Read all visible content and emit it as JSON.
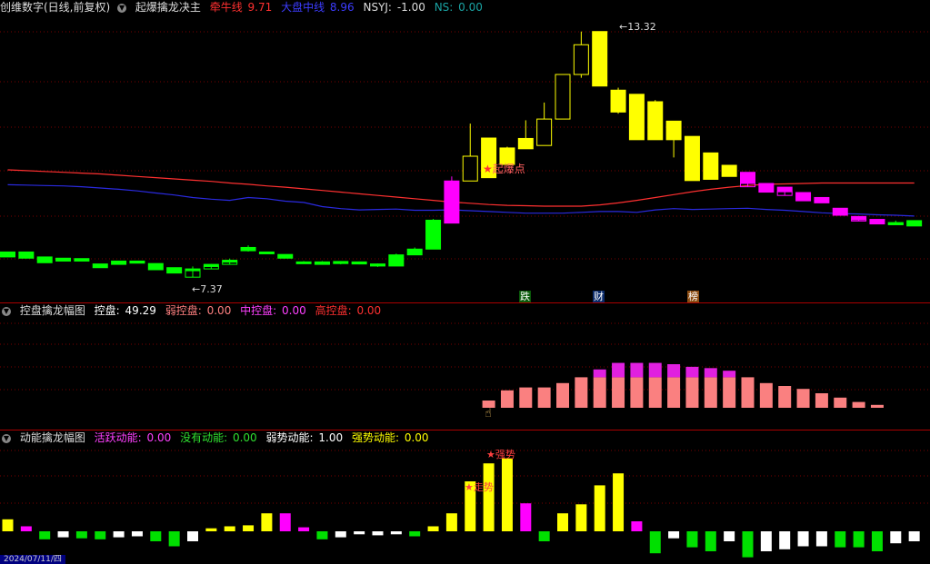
{
  "main": {
    "indicator_label": "创维数字(日线,前复权)",
    "formula_name": "起爆擒龙决主",
    "line1_label": "牵牛线",
    "line1_value": "9.71",
    "line2_label": "大盘中线",
    "line2_value": "8.96",
    "nsyj_label": "NSYJ:",
    "nsyj_value": "-1.00",
    "ns_label": "NS:",
    "ns_value": "0.00",
    "high_marker": "13.32",
    "low_marker": "7.37",
    "signal_text": "起爆点",
    "bottom_tags": [
      "跌",
      "财",
      "榜"
    ],
    "colors": {
      "up_yellow": "#ffff00",
      "down_green": "#00ff00",
      "magenta": "#ff00ff",
      "red_line": "#ff3030",
      "blue_line": "#2a2ae0"
    }
  },
  "sub1": {
    "title": "控盘擒龙幅图",
    "kp_label": "控盘:",
    "kp_value": "49.29",
    "weak_label": "弱控盘:",
    "weak_value": "0.00",
    "mid_label": "中控盘:",
    "mid_value": "0.00",
    "high_label": "高控盘:",
    "high_value": "0.00"
  },
  "sub2": {
    "title": "动能擒龙幅图",
    "active_label": "活跃动能:",
    "active_value": "0.00",
    "none_label": "没有动能:",
    "none_value": "0.00",
    "weak_label": "弱势动能:",
    "weak_value": "1.00",
    "strong_label": "强势动能:",
    "strong_value": "0.00",
    "signal_a": "走势",
    "signal_b": "强势",
    "date": "2024/07/11/四"
  },
  "chart_data": [
    {
      "type": "candlestick",
      "title": "起爆擒龙决主",
      "x": [
        1,
        2,
        3,
        4,
        5,
        6,
        7,
        8,
        9,
        10,
        11,
        12,
        13,
        14,
        15,
        16,
        17,
        18,
        19,
        20,
        21,
        22,
        23,
        24,
        25,
        26,
        27,
        28,
        29,
        30,
        31,
        32,
        33,
        34,
        35,
        36,
        37,
        38,
        39,
        40,
        41,
        42,
        43,
        44,
        45,
        46,
        47,
        48,
        49,
        50
      ],
      "open": [
        7.98,
        7.98,
        7.86,
        7.83,
        7.82,
        7.69,
        7.76,
        7.76,
        7.7,
        7.6,
        7.55,
        7.68,
        7.74,
        8.01,
        7.98,
        7.92,
        7.74,
        7.74,
        7.75,
        7.74,
        7.69,
        7.64,
        7.91,
        8.05,
        8.68,
        9.7,
        10.74,
        10.5,
        10.73,
        10.56,
        11.2,
        12.28,
        13.32,
        11.9,
        11.8,
        11.62,
        11.15,
        10.78,
        10.38,
        10.08,
        9.91,
        9.64,
        9.55,
        9.42,
        9.3,
        9.04,
        8.84,
        8.77,
        8.69,
        8.74
      ],
      "close": [
        7.86,
        7.83,
        7.72,
        7.76,
        7.76,
        7.6,
        7.68,
        7.71,
        7.55,
        7.47,
        7.57,
        7.63,
        7.78,
        8.09,
        7.94,
        7.83,
        7.7,
        7.72,
        7.7,
        7.69,
        7.64,
        7.91,
        8.05,
        8.75,
        9.7,
        10.3,
        9.78,
        10.1,
        10.48,
        11.2,
        12.28,
        13.0,
        12.0,
        11.37,
        10.7,
        10.7,
        10.7,
        9.71,
        9.74,
        9.81,
        9.64,
        9.43,
        9.44,
        9.22,
        9.17,
        8.87,
        8.76,
        8.66,
        8.69,
        8.61
      ],
      "high": [
        7.98,
        7.98,
        7.86,
        7.83,
        7.82,
        7.69,
        7.76,
        7.76,
        7.7,
        7.6,
        7.63,
        7.69,
        7.82,
        8.14,
        7.98,
        7.92,
        7.76,
        7.76,
        7.76,
        7.75,
        7.7,
        7.94,
        8.09,
        8.78,
        9.81,
        11.09,
        10.74,
        10.53,
        11.17,
        11.6,
        12.28,
        13.32,
        13.32,
        11.96,
        11.8,
        11.66,
        11.15,
        10.78,
        10.38,
        10.08,
        9.91,
        9.64,
        9.55,
        9.42,
        9.3,
        9.04,
        8.85,
        8.77,
        8.74,
        8.74
      ],
      "low": [
        7.86,
        7.83,
        7.72,
        7.76,
        7.76,
        7.6,
        7.68,
        7.71,
        7.55,
        7.47,
        7.37,
        7.57,
        7.68,
        7.99,
        7.94,
        7.83,
        7.7,
        7.68,
        7.68,
        7.68,
        7.62,
        7.64,
        7.91,
        8.05,
        8.68,
        9.73,
        9.78,
        10.1,
        10.48,
        10.96,
        11.2,
        12.2,
        12.0,
        11.33,
        10.7,
        10.7,
        10.27,
        9.71,
        9.74,
        9.81,
        9.56,
        9.43,
        9.35,
        9.22,
        9.17,
        8.87,
        8.73,
        8.66,
        8.64,
        8.61
      ],
      "ma_red": [
        9.97,
        9.95,
        9.93,
        9.91,
        9.89,
        9.87,
        9.84,
        9.81,
        9.78,
        9.75,
        9.72,
        9.69,
        9.65,
        9.62,
        9.58,
        9.55,
        9.51,
        9.47,
        9.43,
        9.39,
        9.35,
        9.31,
        9.27,
        9.23,
        9.19,
        9.16,
        9.13,
        9.11,
        9.1,
        9.09,
        9.09,
        9.09,
        9.12,
        9.17,
        9.23,
        9.3,
        9.37,
        9.44,
        9.5,
        9.55,
        9.59,
        9.62,
        9.63,
        9.64,
        9.65,
        9.65,
        9.65,
        9.65,
        9.65,
        9.65
      ],
      "ma_blue": [
        9.61,
        9.6,
        9.59,
        9.58,
        9.56,
        9.53,
        9.5,
        9.46,
        9.41,
        9.36,
        9.3,
        9.26,
        9.23,
        9.3,
        9.27,
        9.21,
        9.18,
        9.08,
        9.03,
        9.0,
        9.01,
        9.02,
        8.99,
        8.99,
        9.0,
        8.98,
        8.96,
        8.94,
        8.92,
        8.92,
        8.92,
        8.94,
        8.96,
        8.96,
        8.94,
        9.0,
        9.03,
        9.01,
        9.02,
        9.03,
        9.04,
        9.01,
        8.99,
        8.96,
        8.93,
        8.91,
        8.9,
        8.88,
        8.87,
        8.85
      ],
      "ylim": [
        7.0,
        13.6
      ]
    },
    {
      "type": "bar",
      "title": "控盘擒龙幅图",
      "x": [
        27,
        28,
        29,
        30,
        31,
        32,
        33,
        34,
        35,
        36,
        37,
        38,
        39,
        40,
        41,
        42,
        43,
        44,
        45,
        46,
        47,
        48
      ],
      "base_values": [
        5,
        12,
        14,
        14,
        17,
        21,
        21,
        21,
        21,
        21,
        21,
        21,
        21,
        21,
        21,
        17,
        15,
        13,
        10,
        7,
        4,
        2
      ],
      "magenta_top": [
        0,
        0,
        0,
        0,
        0,
        0,
        6,
        11,
        11,
        11,
        10,
        8,
        7,
        5,
        0,
        0,
        0,
        0,
        0,
        0,
        0,
        0
      ],
      "ylim": [
        0,
        50
      ]
    },
    {
      "type": "bar",
      "title": "动能擒龙幅图",
      "x": [
        1,
        2,
        3,
        4,
        5,
        6,
        7,
        8,
        9,
        10,
        11,
        12,
        13,
        14,
        15,
        16,
        17,
        18,
        19,
        20,
        21,
        22,
        23,
        24,
        25,
        26,
        27,
        28,
        29,
        30,
        31,
        32,
        33,
        34,
        35,
        36,
        37,
        38,
        39,
        40,
        41,
        42,
        43,
        44,
        45,
        46,
        47,
        48,
        49,
        50
      ],
      "values": [
        1.2,
        0.5,
        -0.8,
        -0.6,
        -0.7,
        -0.8,
        -0.6,
        -0.5,
        -1.0,
        -1.5,
        -1.0,
        0.3,
        0.5,
        0.6,
        1.8,
        1.8,
        0.4,
        -0.8,
        -0.6,
        -0.3,
        -0.4,
        -0.3,
        -0.5,
        0.5,
        1.8,
        5.0,
        6.8,
        7.3,
        2.8,
        -1.0,
        1.8,
        2.7,
        4.6,
        5.8,
        1.0,
        -2.2,
        -0.7,
        -1.6,
        -2.0,
        -1.0,
        -2.6,
        -2.0,
        -1.8,
        -1.5,
        -1.5,
        -1.6,
        -1.6,
        -2.0,
        -1.2,
        -1.0
      ],
      "colors": [
        "y",
        "m",
        "g",
        "w",
        "g",
        "g",
        "w",
        "w",
        "g",
        "g",
        "w",
        "y",
        "y",
        "y",
        "y",
        "m",
        "m",
        "g",
        "w",
        "w",
        "w",
        "w",
        "g",
        "y",
        "y",
        "y",
        "y",
        "y",
        "m",
        "g",
        "y",
        "y",
        "y",
        "y",
        "m",
        "g",
        "w",
        "g",
        "g",
        "w",
        "g",
        "w",
        "w",
        "w",
        "w",
        "g",
        "g",
        "g",
        "w",
        "w"
      ],
      "ylim": [
        -3,
        8
      ]
    }
  ]
}
